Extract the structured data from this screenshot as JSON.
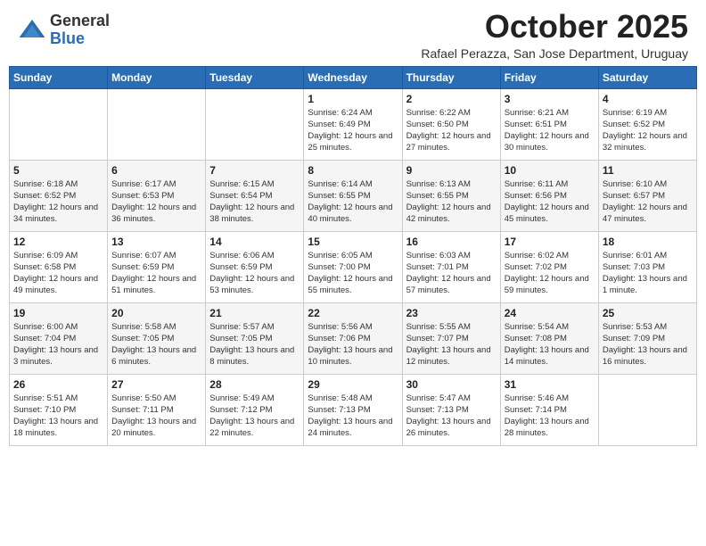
{
  "logo": {
    "general": "General",
    "blue": "Blue"
  },
  "title": "October 2025",
  "subtitle": "Rafael Perazza, San Jose Department, Uruguay",
  "days_header": [
    "Sunday",
    "Monday",
    "Tuesday",
    "Wednesday",
    "Thursday",
    "Friday",
    "Saturday"
  ],
  "weeks": [
    [
      null,
      null,
      null,
      {
        "day": "1",
        "sunrise": "Sunrise: 6:24 AM",
        "sunset": "Sunset: 6:49 PM",
        "daylight": "Daylight: 12 hours and 25 minutes."
      },
      {
        "day": "2",
        "sunrise": "Sunrise: 6:22 AM",
        "sunset": "Sunset: 6:50 PM",
        "daylight": "Daylight: 12 hours and 27 minutes."
      },
      {
        "day": "3",
        "sunrise": "Sunrise: 6:21 AM",
        "sunset": "Sunset: 6:51 PM",
        "daylight": "Daylight: 12 hours and 30 minutes."
      },
      {
        "day": "4",
        "sunrise": "Sunrise: 6:19 AM",
        "sunset": "Sunset: 6:52 PM",
        "daylight": "Daylight: 12 hours and 32 minutes."
      }
    ],
    [
      {
        "day": "5",
        "sunrise": "Sunrise: 6:18 AM",
        "sunset": "Sunset: 6:52 PM",
        "daylight": "Daylight: 12 hours and 34 minutes."
      },
      {
        "day": "6",
        "sunrise": "Sunrise: 6:17 AM",
        "sunset": "Sunset: 6:53 PM",
        "daylight": "Daylight: 12 hours and 36 minutes."
      },
      {
        "day": "7",
        "sunrise": "Sunrise: 6:15 AM",
        "sunset": "Sunset: 6:54 PM",
        "daylight": "Daylight: 12 hours and 38 minutes."
      },
      {
        "day": "8",
        "sunrise": "Sunrise: 6:14 AM",
        "sunset": "Sunset: 6:55 PM",
        "daylight": "Daylight: 12 hours and 40 minutes."
      },
      {
        "day": "9",
        "sunrise": "Sunrise: 6:13 AM",
        "sunset": "Sunset: 6:55 PM",
        "daylight": "Daylight: 12 hours and 42 minutes."
      },
      {
        "day": "10",
        "sunrise": "Sunrise: 6:11 AM",
        "sunset": "Sunset: 6:56 PM",
        "daylight": "Daylight: 12 hours and 45 minutes."
      },
      {
        "day": "11",
        "sunrise": "Sunrise: 6:10 AM",
        "sunset": "Sunset: 6:57 PM",
        "daylight": "Daylight: 12 hours and 47 minutes."
      }
    ],
    [
      {
        "day": "12",
        "sunrise": "Sunrise: 6:09 AM",
        "sunset": "Sunset: 6:58 PM",
        "daylight": "Daylight: 12 hours and 49 minutes."
      },
      {
        "day": "13",
        "sunrise": "Sunrise: 6:07 AM",
        "sunset": "Sunset: 6:59 PM",
        "daylight": "Daylight: 12 hours and 51 minutes."
      },
      {
        "day": "14",
        "sunrise": "Sunrise: 6:06 AM",
        "sunset": "Sunset: 6:59 PM",
        "daylight": "Daylight: 12 hours and 53 minutes."
      },
      {
        "day": "15",
        "sunrise": "Sunrise: 6:05 AM",
        "sunset": "Sunset: 7:00 PM",
        "daylight": "Daylight: 12 hours and 55 minutes."
      },
      {
        "day": "16",
        "sunrise": "Sunrise: 6:03 AM",
        "sunset": "Sunset: 7:01 PM",
        "daylight": "Daylight: 12 hours and 57 minutes."
      },
      {
        "day": "17",
        "sunrise": "Sunrise: 6:02 AM",
        "sunset": "Sunset: 7:02 PM",
        "daylight": "Daylight: 12 hours and 59 minutes."
      },
      {
        "day": "18",
        "sunrise": "Sunrise: 6:01 AM",
        "sunset": "Sunset: 7:03 PM",
        "daylight": "Daylight: 13 hours and 1 minute."
      }
    ],
    [
      {
        "day": "19",
        "sunrise": "Sunrise: 6:00 AM",
        "sunset": "Sunset: 7:04 PM",
        "daylight": "Daylight: 13 hours and 3 minutes."
      },
      {
        "day": "20",
        "sunrise": "Sunrise: 5:58 AM",
        "sunset": "Sunset: 7:05 PM",
        "daylight": "Daylight: 13 hours and 6 minutes."
      },
      {
        "day": "21",
        "sunrise": "Sunrise: 5:57 AM",
        "sunset": "Sunset: 7:05 PM",
        "daylight": "Daylight: 13 hours and 8 minutes."
      },
      {
        "day": "22",
        "sunrise": "Sunrise: 5:56 AM",
        "sunset": "Sunset: 7:06 PM",
        "daylight": "Daylight: 13 hours and 10 minutes."
      },
      {
        "day": "23",
        "sunrise": "Sunrise: 5:55 AM",
        "sunset": "Sunset: 7:07 PM",
        "daylight": "Daylight: 13 hours and 12 minutes."
      },
      {
        "day": "24",
        "sunrise": "Sunrise: 5:54 AM",
        "sunset": "Sunset: 7:08 PM",
        "daylight": "Daylight: 13 hours and 14 minutes."
      },
      {
        "day": "25",
        "sunrise": "Sunrise: 5:53 AM",
        "sunset": "Sunset: 7:09 PM",
        "daylight": "Daylight: 13 hours and 16 minutes."
      }
    ],
    [
      {
        "day": "26",
        "sunrise": "Sunrise: 5:51 AM",
        "sunset": "Sunset: 7:10 PM",
        "daylight": "Daylight: 13 hours and 18 minutes."
      },
      {
        "day": "27",
        "sunrise": "Sunrise: 5:50 AM",
        "sunset": "Sunset: 7:11 PM",
        "daylight": "Daylight: 13 hours and 20 minutes."
      },
      {
        "day": "28",
        "sunrise": "Sunrise: 5:49 AM",
        "sunset": "Sunset: 7:12 PM",
        "daylight": "Daylight: 13 hours and 22 minutes."
      },
      {
        "day": "29",
        "sunrise": "Sunrise: 5:48 AM",
        "sunset": "Sunset: 7:13 PM",
        "daylight": "Daylight: 13 hours and 24 minutes."
      },
      {
        "day": "30",
        "sunrise": "Sunrise: 5:47 AM",
        "sunset": "Sunset: 7:13 PM",
        "daylight": "Daylight: 13 hours and 26 minutes."
      },
      {
        "day": "31",
        "sunrise": "Sunrise: 5:46 AM",
        "sunset": "Sunset: 7:14 PM",
        "daylight": "Daylight: 13 hours and 28 minutes."
      },
      null
    ]
  ]
}
